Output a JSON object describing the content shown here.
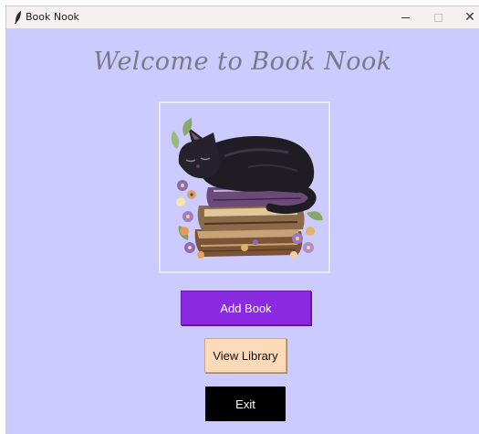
{
  "window": {
    "title": "Book Nook",
    "minimize_glyph": "",
    "close_glyph": "✕"
  },
  "main": {
    "heading": "Welcome to Book Nook",
    "image": {
      "icon": "sleeping-cat-on-books-illustration"
    },
    "buttons": {
      "add_book": "Add Book",
      "view_library": "View Library",
      "exit": "Exit"
    }
  },
  "colors": {
    "background": "#cccbff",
    "titlebar": "#f6f0ef",
    "add_button": "#8a2be2",
    "view_button": "#ffdab9",
    "exit_button": "#000000",
    "heading_text": "#7a7a86"
  }
}
